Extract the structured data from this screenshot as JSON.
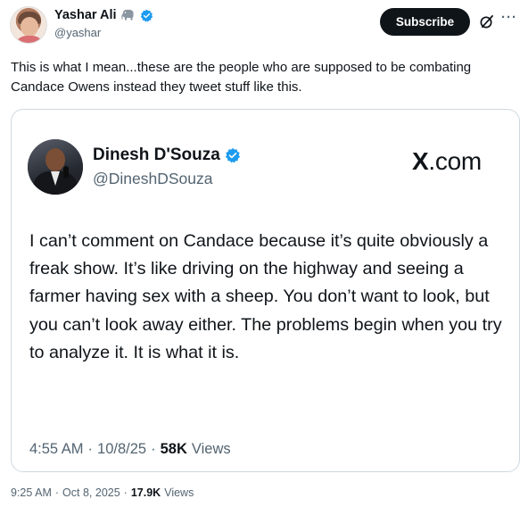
{
  "post": {
    "author": {
      "name": "Yashar Ali",
      "handle": "@yashar",
      "elephant_icon": "elephant-icon",
      "verified_icon": "verified-badge-icon"
    },
    "subscribe_label": "Subscribe",
    "text": "This is what I mean...these are the people who are supposed to be combating Candace Owens instead they tweet stuff like this.",
    "meta": {
      "time": "9:25 AM",
      "date": "Oct 8, 2025",
      "views_count": "17.9K",
      "views_label": "Views"
    }
  },
  "quoted_card": {
    "author": {
      "name": "Dinesh D'Souza",
      "handle": "@DineshDSouza",
      "verified_icon": "verified-badge-icon"
    },
    "logo_x": "X",
    "logo_rest": ".com",
    "text": "I can’t comment on Candace because it’s quite obviously a freak show. It’s like driving on the highway and seeing a farmer having sex with a sheep. You don’t want to look, but you can’t look away either. The problems begin when you try to analyze it. It is what it is.",
    "meta": {
      "time": "4:55 AM",
      "date": "10/8/25",
      "views_count": "58K",
      "views_label": "Views"
    }
  },
  "colors": {
    "text_primary": "#0f1419",
    "text_secondary": "#536471",
    "verified_blue": "#1d9bf0",
    "border": "#cfd9de",
    "subscribe_bg": "#0f1419"
  }
}
